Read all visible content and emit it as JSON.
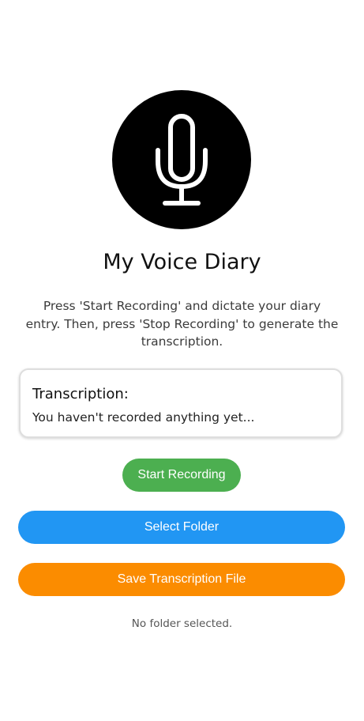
{
  "app": {
    "logo_icon": "microphone-icon",
    "title": "My Voice Diary",
    "intro": "Press 'Start Recording' and dictate your diary entry. Then, press 'Stop Recording' to generate the transcription."
  },
  "transcription": {
    "heading": "Transcription:",
    "text": "You haven't recorded anything yet..."
  },
  "buttons": {
    "start_recording": "Start Recording",
    "select_folder": "Select Folder",
    "save_file": "Save Transcription File"
  },
  "status": {
    "folder": "No folder selected."
  },
  "colors": {
    "start": "#4caf50",
    "folder": "#2196f3",
    "save": "#fb8c00"
  }
}
